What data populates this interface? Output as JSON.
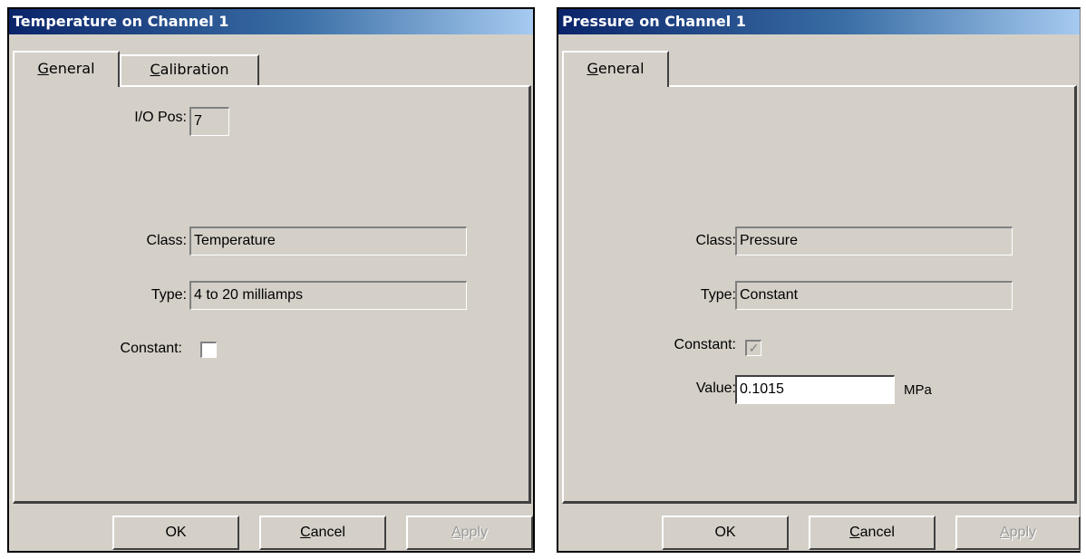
{
  "left_dialog": {
    "title": "Temperature on Channel 1",
    "tabs": [
      {
        "label": "General",
        "accel": "G",
        "rest": "eneral",
        "selected": true
      },
      {
        "label": "Calibration",
        "accel": "C",
        "rest": "alibration",
        "selected": false
      }
    ],
    "io_pos_label": "I/O Pos:",
    "io_pos_value": "7",
    "class_label": "Class:",
    "class_value": "Temperature",
    "type_label": "Type:",
    "type_value": "4 to 20 milliamps",
    "constant_label": "Constant:",
    "constant_checked": false,
    "buttons": {
      "ok": "OK",
      "cancel_accel": "C",
      "cancel_rest": "ancel",
      "apply_accel": "A",
      "apply_rest": "pply"
    }
  },
  "right_dialog": {
    "title": "Pressure on Channel 1",
    "tabs": [
      {
        "label": "General",
        "accel": "G",
        "rest": "eneral",
        "selected": true
      }
    ],
    "class_label": "Class:",
    "class_value": "Pressure",
    "type_label": "Type:",
    "type_value": "Constant",
    "constant_label": "Constant:",
    "constant_checked": true,
    "value_label": "Value:",
    "value_value": "0.1015",
    "value_unit": "MPa",
    "buttons": {
      "ok": "OK",
      "cancel_accel": "C",
      "cancel_rest": "ancel",
      "apply_accel": "A",
      "apply_rest": "pply"
    }
  },
  "colors": {
    "titlebar_start": "#0a246a",
    "titlebar_end": "#a6caf0",
    "face": "#d4d0c8"
  }
}
